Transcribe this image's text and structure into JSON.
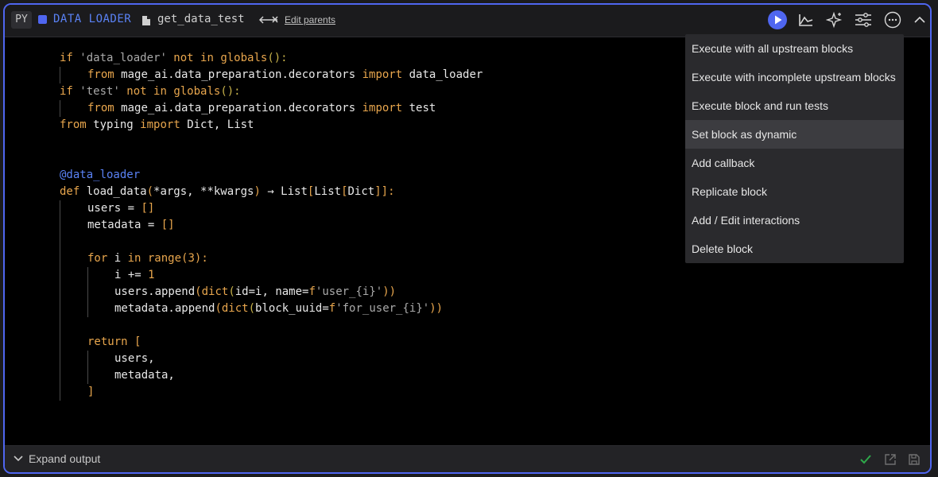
{
  "header": {
    "lang_badge": "PY",
    "block_type": "DATA LOADER",
    "block_name": "get_data_test",
    "edit_parents": "Edit parents"
  },
  "code": {
    "l1": {
      "a": "if ",
      "b": "'data_loader'",
      "c": " not in ",
      "d": "globals",
      "e": "():"
    },
    "l2": {
      "a": "from ",
      "b": "mage_ai.data_preparation.decorators ",
      "c": "import ",
      "d": "data_loader"
    },
    "l3": {
      "a": "if ",
      "b": "'test'",
      "c": " not in ",
      "d": "globals",
      "e": "():"
    },
    "l4": {
      "a": "from ",
      "b": "mage_ai.data_preparation.decorators ",
      "c": "import ",
      "d": "test"
    },
    "l5": {
      "a": "from ",
      "b": "typing ",
      "c": "import ",
      "d": "Dict, List"
    },
    "l8": {
      "a": "@data_loader"
    },
    "l9": {
      "a": "def ",
      "b": "load_data",
      "c": "(",
      "d": "*args, **kwargs",
      "e": ")",
      "f": " → List",
      "g": "[",
      "h": "List",
      "i": "[",
      "j": "Dict",
      "k": "]]",
      "l": ":"
    },
    "l10": {
      "a": "users = ",
      "b": "[]"
    },
    "l11": {
      "a": "metadata = ",
      "b": "[]"
    },
    "l13": {
      "a": "for ",
      "b": "i ",
      "c": "in ",
      "d": "range",
      "e": "(",
      "f": "3",
      "g": "):"
    },
    "l14": {
      "a": "i += ",
      "b": "1"
    },
    "l15": {
      "a": "users.append",
      "b": "(",
      "c": "dict",
      "d": "(",
      "e": "id=i, name=",
      "f": "f",
      "g": "'user_{i}'",
      "h": "))"
    },
    "l16": {
      "a": "metadata.append",
      "b": "(",
      "c": "dict",
      "d": "(",
      "e": "block_uuid=",
      "f": "f",
      "g": "'for_user_{i}'",
      "h": "))"
    },
    "l18": {
      "a": "return ",
      "b": "["
    },
    "l19": {
      "a": "users,"
    },
    "l20": {
      "a": "metadata,"
    },
    "l21": {
      "a": "]"
    }
  },
  "menu": {
    "items": [
      "Execute with all upstream blocks",
      "Execute with incomplete upstream blocks",
      "Execute block and run tests",
      "Set block as dynamic",
      "Add callback",
      "Replicate block",
      "Add / Edit interactions",
      "Delete block"
    ],
    "highlighted": "Set block as dynamic"
  },
  "footer": {
    "expand_label": "Expand output"
  },
  "colors": {
    "accent": "#4f66f0",
    "success": "#2ea84a",
    "keyword": "#e8a64d"
  }
}
